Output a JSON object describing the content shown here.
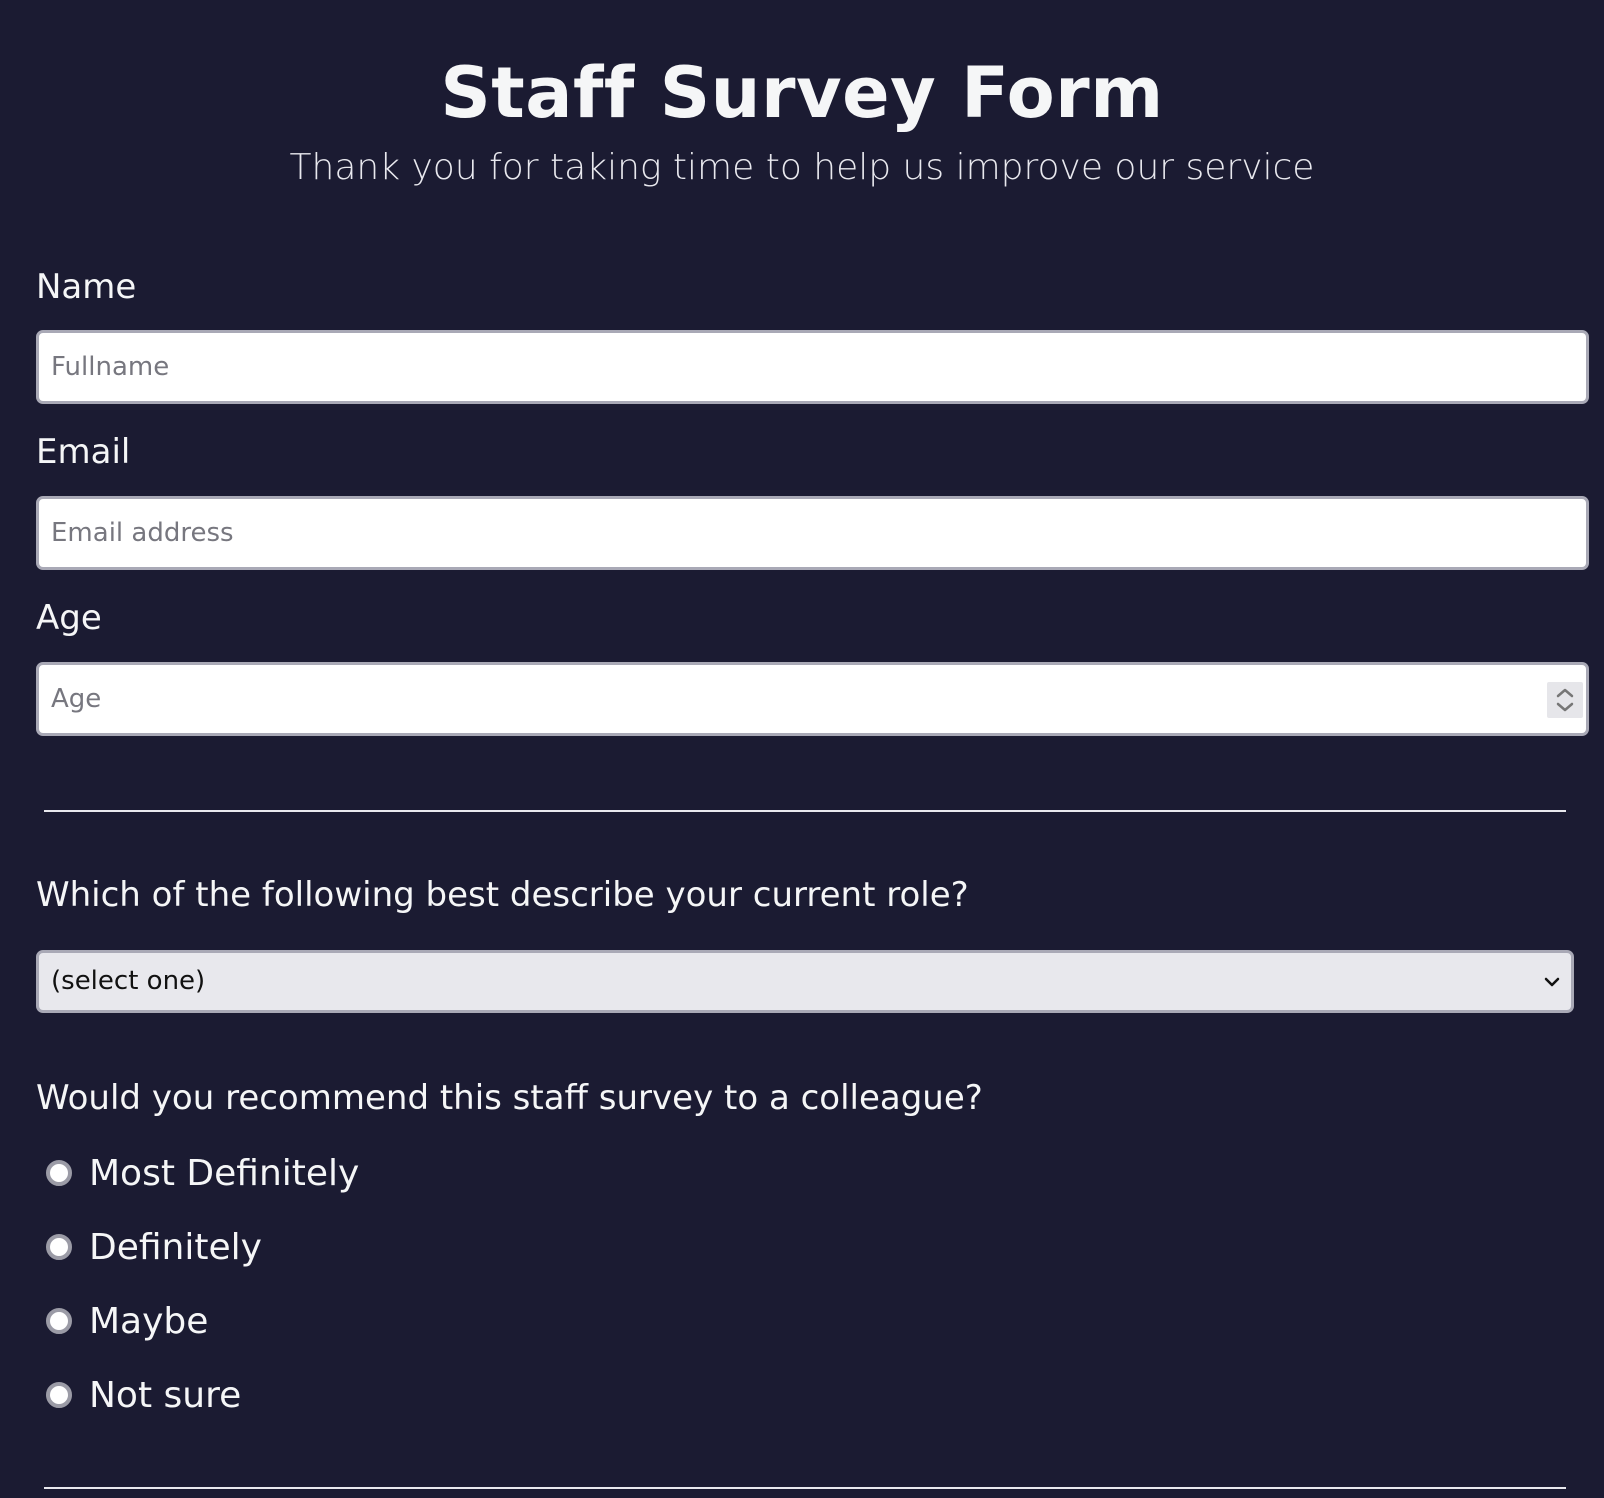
{
  "header": {
    "title": "Staff Survey Form",
    "subtitle": "Thank you for taking time to help us improve our service"
  },
  "form": {
    "name": {
      "label": "Name",
      "placeholder": "Fullname",
      "value": ""
    },
    "email": {
      "label": "Email",
      "placeholder": "Email address",
      "value": ""
    },
    "age": {
      "label": "Age",
      "placeholder": "Age",
      "value": ""
    },
    "role": {
      "question": "Which of the following best describe your current role?",
      "selected": "(select one)"
    },
    "recommend": {
      "question": "Would you recommend this staff survey to a colleague?",
      "options": [
        "Most Definitely",
        "Definitely",
        "Maybe",
        "Not sure"
      ],
      "selected": null
    }
  },
  "icons": {
    "age_spinner": "up-down-arrows-icon",
    "select_chevron": "chevron-down-icon",
    "radio": "radio-circle-icon"
  },
  "colors": {
    "background": "#1b1b32",
    "text": "#f5f6f7",
    "input_bg": "#ffffff",
    "select_bg": "#e8e8ed",
    "input_border": "#a9a9b6"
  }
}
